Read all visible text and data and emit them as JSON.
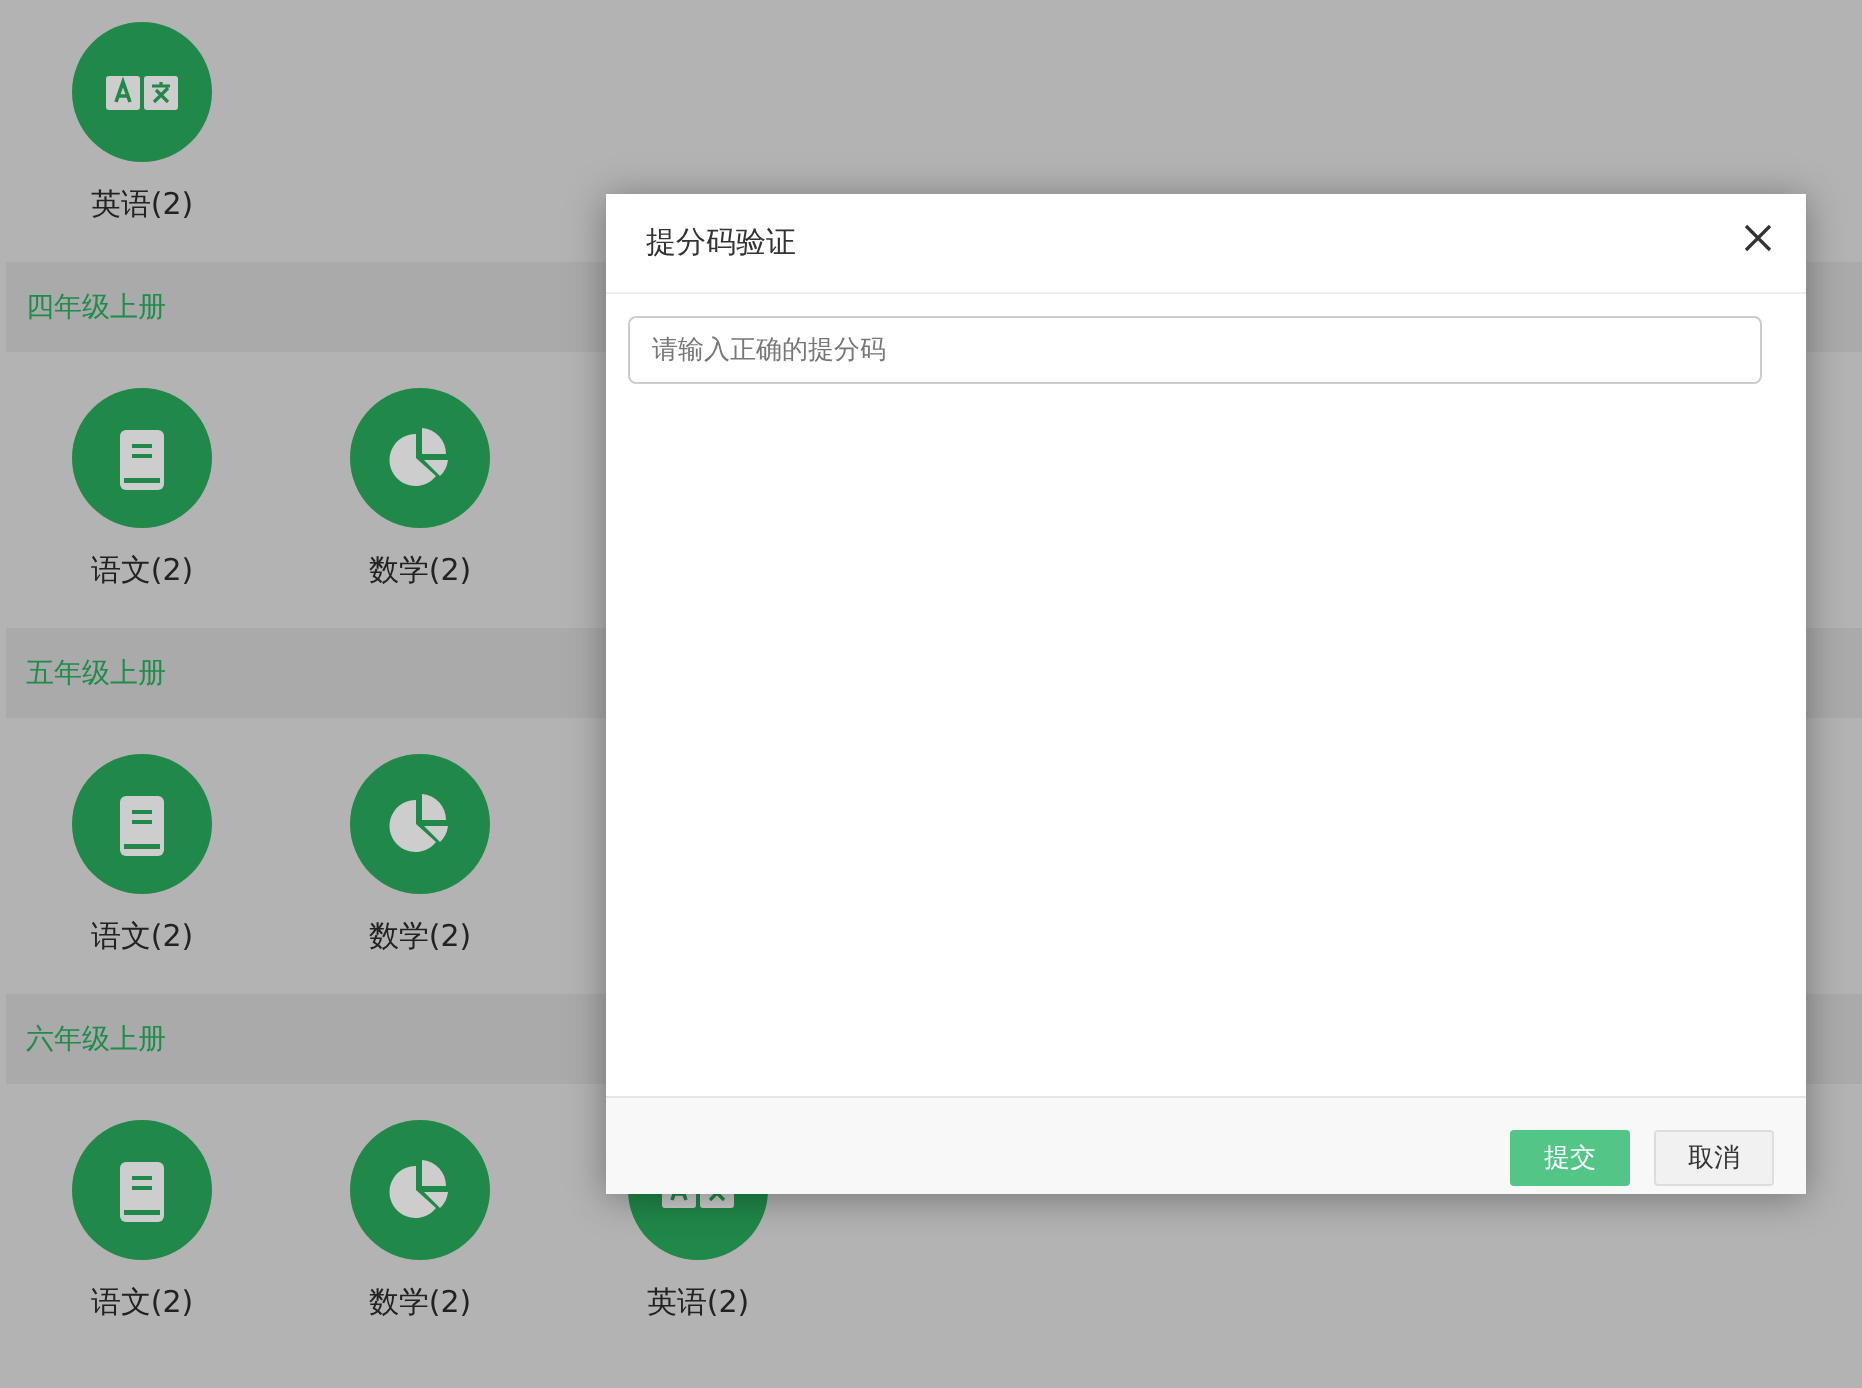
{
  "sections": [
    {
      "items": [
        {
          "kind": "translate",
          "label": "英语(2)"
        }
      ]
    },
    {
      "header": "四年级上册",
      "items": [
        {
          "kind": "book",
          "label": "语文(2)"
        },
        {
          "kind": "pie",
          "label": "数学(2)"
        }
      ]
    },
    {
      "header": "五年级上册",
      "items": [
        {
          "kind": "book",
          "label": "语文(2)"
        },
        {
          "kind": "pie",
          "label": "数学(2)"
        }
      ]
    },
    {
      "header": "六年级上册",
      "items": [
        {
          "kind": "book",
          "label": "语文(2)"
        },
        {
          "kind": "pie",
          "label": "数学(2)"
        },
        {
          "kind": "translate",
          "label": "英语(2)"
        }
      ]
    }
  ],
  "dialog": {
    "title": "提分码验证",
    "input": {
      "placeholder": "请输入正确的提分码"
    },
    "buttons": [
      {
        "label": "提交",
        "kind": "primary"
      },
      {
        "label": "取消",
        "kind": "default"
      }
    ]
  }
}
